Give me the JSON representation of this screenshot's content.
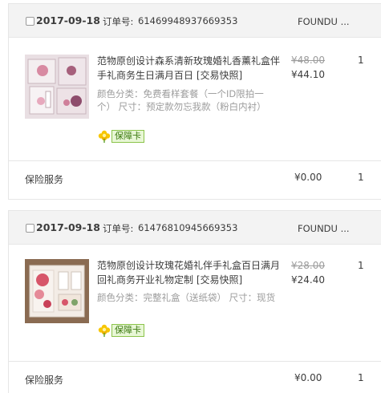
{
  "colors": {
    "header_bg": "#f3f3f3",
    "border": "#e6e6e6",
    "muted": "#9c9c9c",
    "badge_green": "#3c7a10"
  },
  "orders": [
    {
      "date": "2017-09-18",
      "order_no_label": "订单号:",
      "order_no": "61469948937669353",
      "shop": "FOUNDU ...",
      "item": {
        "title": "范物原创设计森系清新玫瑰婚礼香薰礼盒伴手礼商务生日满月百日 [交易快照]",
        "sku": "颜色分类：免费看样套餐（一个ID限拍一个）  尺寸：预定款勿忘我款（粉白内衬）",
        "badge": "保障卡",
        "badge_icon": "flower-icon",
        "price_original": "¥48.00",
        "price_paid": "¥44.10",
        "quantity": "1"
      },
      "service": {
        "label": "保险服务",
        "price": "¥0.00",
        "quantity": "1"
      }
    },
    {
      "date": "2017-09-18",
      "order_no_label": "订单号:",
      "order_no": "61476810945669353",
      "shop": "FOUNDU ...",
      "item": {
        "title": "范物原创设计玫瑰花婚礼伴手礼盒百日满月回礼商务开业礼物定制 [交易快照]",
        "sku": "颜色分类：完整礼盒（送纸袋）  尺寸：现货",
        "badge": "保障卡",
        "badge_icon": "flower-icon",
        "price_original": "¥28.00",
        "price_paid": "¥24.40",
        "quantity": "1"
      },
      "service": {
        "label": "保险服务",
        "price": "¥0.00",
        "quantity": "1"
      }
    }
  ]
}
